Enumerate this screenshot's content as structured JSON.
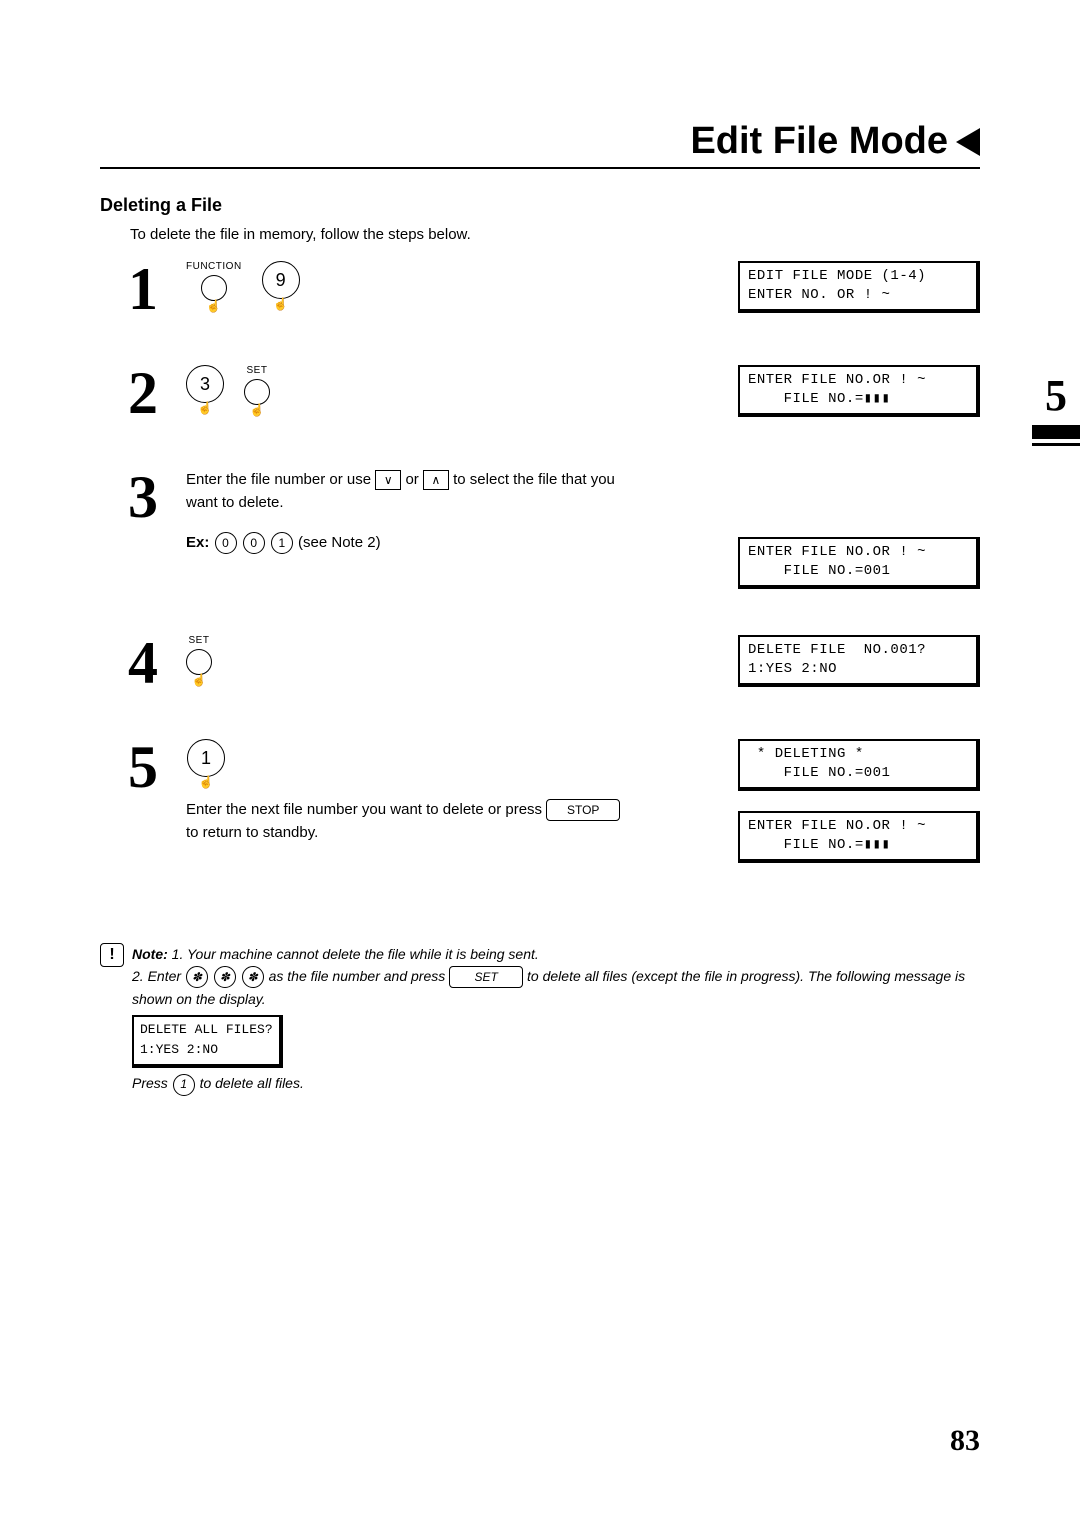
{
  "header": {
    "title": "Edit File Mode"
  },
  "section": {
    "title": "Deleting a File",
    "intro": "To delete the file in memory, follow the steps below."
  },
  "side_tab": "5",
  "page_number": "83",
  "buttons": {
    "function": "FUNCTION",
    "set": "SET",
    "stop": "STOP",
    "key9": "9",
    "key3": "3",
    "key1": "1",
    "key0": "0",
    "star": "✽",
    "down": "∨",
    "up": "∧"
  },
  "steps": {
    "s1": {
      "num": "1",
      "lcd": "EDIT FILE MODE (1-4)\nENTER NO. OR ! ~"
    },
    "s2": {
      "num": "2",
      "lcd": "ENTER FILE NO.OR ! ~\n    FILE NO.=▮▮▮"
    },
    "s3": {
      "num": "3",
      "text_a": "Enter the file number or use ",
      "text_b": " or ",
      "text_c": " to select the file that you want to delete.",
      "ex_label": "Ex:",
      "ex_after": " (see Note 2)",
      "lcd": "ENTER FILE NO.OR ! ~\n    FILE NO.=001"
    },
    "s4": {
      "num": "4",
      "lcd": "DELETE FILE  NO.001?\n1:YES 2:NO"
    },
    "s5": {
      "num": "5",
      "text_a": "Enter the next file number you want to delete or press ",
      "text_b": " to return to standby.",
      "lcd_a": " * DELETING *\n    FILE NO.=001",
      "lcd_b": "ENTER FILE NO.OR ! ~\n    FILE NO.=▮▮▮"
    }
  },
  "note": {
    "label": "Note:",
    "n1": "1. Your machine cannot delete the file while it is being sent.",
    "n2_a": "2. Enter ",
    "n2_b": " as the file number and press ",
    "n2_c": " to delete all files (except the file in progress).  The following message is shown on the display.",
    "lcd": "DELETE ALL FILES?\n1:YES 2:NO",
    "n2_d": "Press ",
    "n2_e": " to delete all files."
  }
}
